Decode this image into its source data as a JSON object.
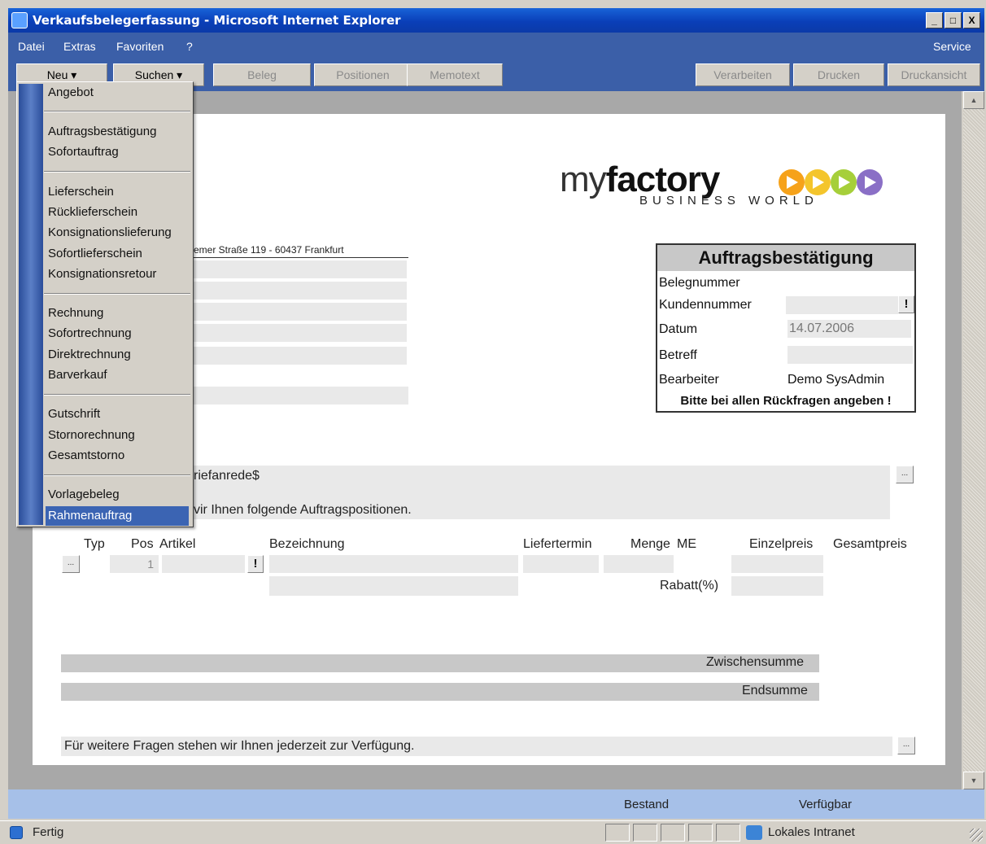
{
  "window": {
    "title": "Verkaufsbelegerfassung - Microsoft Internet Explorer",
    "buttons": [
      "_",
      "□",
      "X"
    ]
  },
  "menubar": {
    "items": [
      "Datei",
      "Extras",
      "Favoriten",
      "?"
    ],
    "right": "Service"
  },
  "toolbar": {
    "neu": "Neu ▾",
    "suchen": "Suchen ▾",
    "beleg": "Beleg",
    "positionen": "Positionen",
    "memotext": "Memotext",
    "verarbeiten": "Verarbeiten",
    "drucken": "Drucken",
    "druckansicht": "Druckansicht"
  },
  "menu": {
    "groups": [
      [
        "Angebot"
      ],
      [
        "Auftragsbestätigung",
        "Sofortauftrag"
      ],
      [
        "Lieferschein",
        "Rücklieferschein",
        "Konsignationslieferung",
        "Sofortlieferschein",
        "Konsignationsretour"
      ],
      [
        "Rechnung",
        "Sofortrechnung",
        "Direktrechnung",
        "Barverkauf"
      ],
      [
        "Gutschrift",
        "Stornorechnung",
        "Gesamtstorno"
      ],
      [
        "Vorlagebeleg",
        "Rahmenauftrag"
      ]
    ],
    "selected": "Rahmenauftrag"
  },
  "logo": {
    "my": "my",
    "factory": "factory",
    "sub": "BUSINESS  WORLD",
    "colors": [
      "#f6a21a",
      "#f4c52c",
      "#a6cf3a",
      "#8a6fc6"
    ]
  },
  "address": {
    "sender": "emer Straße 119 - 60437 Frankfurt"
  },
  "auftrag": {
    "title": "Auftragsbestätigung",
    "belegnummer": "Belegnummer",
    "kundennummer": "Kundennummer",
    "datum": "Datum",
    "datum_value": "14.07.2006",
    "betreff": "Betreff",
    "bearbeiter": "Bearbeiter",
    "bearbeiter_value": "Demo SysAdmin",
    "hint": "Bitte bei allen Rückfragen angeben !"
  },
  "letter": {
    "salutation": "riefanrede$",
    "intro": "vir Ihnen folgende Auftragspositionen.",
    "closing": "Für weitere Fragen stehen wir Ihnen jederzeit zur Verfügung."
  },
  "table": {
    "headers": {
      "typ": "Typ",
      "pos": "Pos",
      "artikel": "Artikel",
      "bezeichnung": "Bezeichnung",
      "liefertermin": "Liefertermin",
      "menge": "Menge",
      "me": "ME",
      "einzelpreis": "Einzelpreis",
      "gesamtpreis": "Gesamtpreis"
    },
    "pos_value": "1",
    "rabatt": "Rabatt(%)"
  },
  "totals": {
    "zwischensumme": "Zwischensumme",
    "endsumme": "Endsumme"
  },
  "bottombar": {
    "bestand": "Bestand",
    "verfuegbar": "Verfügbar"
  },
  "status": {
    "text": "Fertig",
    "zone": "Lokales Intranet"
  },
  "buttons": {
    "dots": "...",
    "excl": "!"
  }
}
